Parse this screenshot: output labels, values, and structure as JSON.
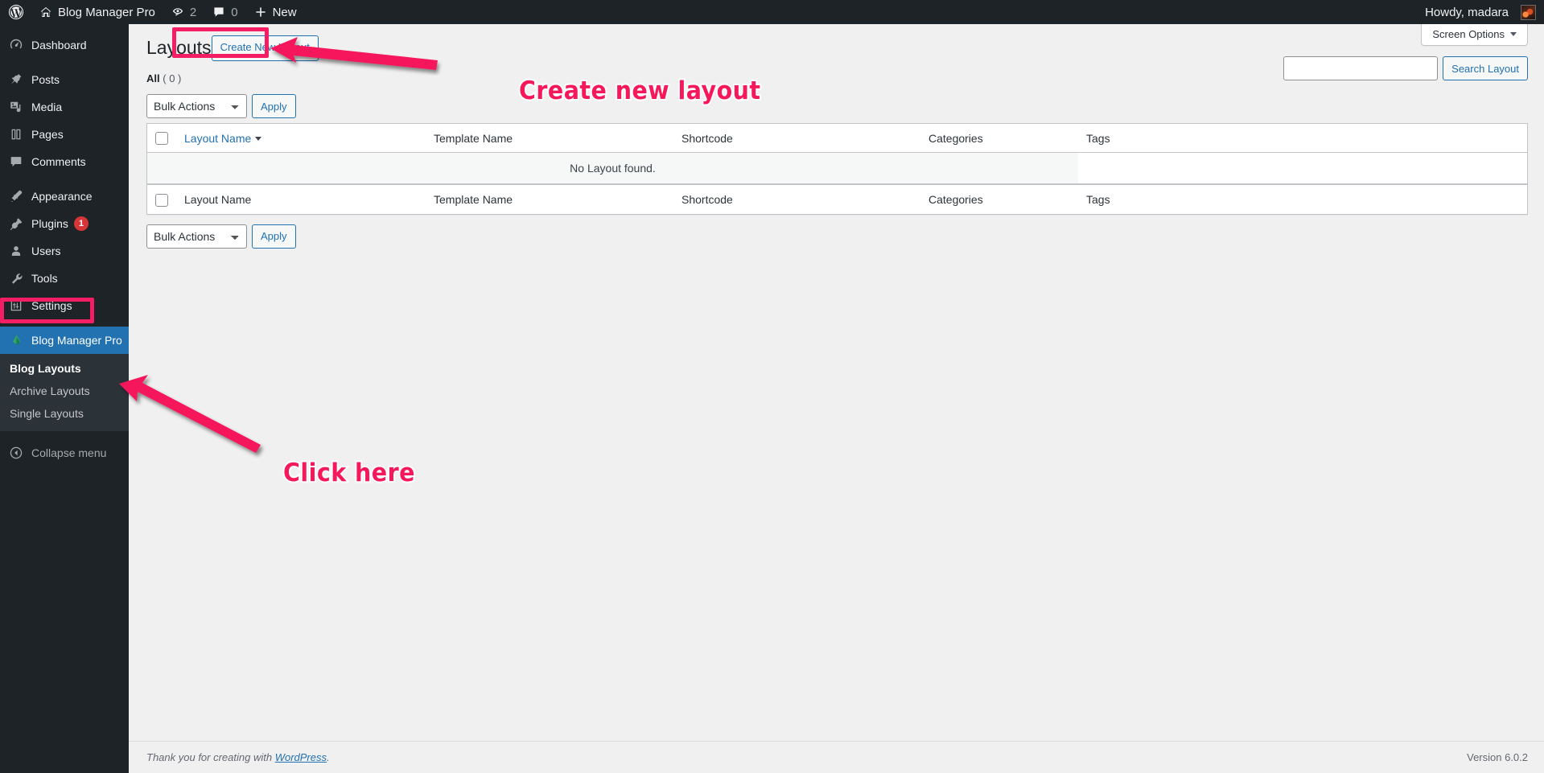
{
  "adminbar": {
    "wp_logo_icon": "wordpress-logo-icon",
    "site_icon": "home-icon",
    "site_name": "Blog Manager Pro",
    "updates_icon": "updates-icon",
    "updates_count": "2",
    "comments_icon": "comment-bubble-icon",
    "comments_count": "0",
    "new_icon": "plus-icon",
    "new_label": "New",
    "howdy": "Howdy, madara",
    "avatar_name": "user-avatar"
  },
  "sidebar": {
    "items": [
      {
        "label": "Dashboard",
        "icon": "dashboard-icon",
        "name": "dashboard"
      },
      {
        "label": "Posts",
        "icon": "pin-icon",
        "name": "posts"
      },
      {
        "label": "Media",
        "icon": "media-icon",
        "name": "media"
      },
      {
        "label": "Pages",
        "icon": "page-icon",
        "name": "pages"
      },
      {
        "label": "Comments",
        "icon": "comment-icon",
        "name": "comments"
      },
      {
        "label": "Appearance",
        "icon": "paintbrush-icon",
        "name": "appearance"
      },
      {
        "label": "Plugins",
        "icon": "plug-icon",
        "name": "plugins",
        "badge": "1"
      },
      {
        "label": "Users",
        "icon": "user-icon",
        "name": "users"
      },
      {
        "label": "Tools",
        "icon": "wrench-icon",
        "name": "tools"
      },
      {
        "label": "Settings",
        "icon": "sliders-icon",
        "name": "settings"
      },
      {
        "label": "Blog Manager Pro",
        "icon": "blog-manager-icon",
        "name": "blog-manager-pro",
        "current": true
      }
    ],
    "submenu": [
      {
        "label": "Blog Layouts",
        "name": "blog-layouts",
        "current": true
      },
      {
        "label": "Archive Layouts",
        "name": "archive-layouts"
      },
      {
        "label": "Single Layouts",
        "name": "single-layouts"
      }
    ],
    "collapse_label": "Collapse menu",
    "collapse_icon": "collapse-arrow-icon"
  },
  "screen_meta": {
    "screen_options_label": "Screen Options",
    "caret_icon": "chevron-down-icon"
  },
  "main": {
    "page_title": "Layouts",
    "create_button": "Create New Layout",
    "filters": [
      {
        "label": "All",
        "count": "( 0 )"
      }
    ],
    "bulk_actions_value": "Bulk Actions",
    "bulk_actions_options": [
      "Bulk Actions"
    ],
    "apply_label": "Apply",
    "search": {
      "value": "",
      "placeholder": "",
      "button_label": "Search Layout"
    },
    "table": {
      "columns": [
        "Layout Name",
        "Template Name",
        "Shortcode",
        "Categories",
        "Tags"
      ],
      "sort_column": "Layout Name",
      "sort_indicator_icon": "sort-desc-icon",
      "select_all_icon": "checkbox-unchecked-icon",
      "empty_message": "No Layout found.",
      "rows": []
    }
  },
  "footer": {
    "thanks_prefix": "Thank you for creating with ",
    "wordpress_link": "WordPress",
    "thanks_suffix": ".",
    "version": "Version 6.0.2"
  },
  "annotations": {
    "create_new_layout_text": "Create new layout",
    "click_here_text": "Click here",
    "highlight_color": "#f5185b",
    "arrow_create_icon": "arrow-pointing-left-icon",
    "arrow_click_icon": "arrow-pointing-upleft-icon"
  }
}
